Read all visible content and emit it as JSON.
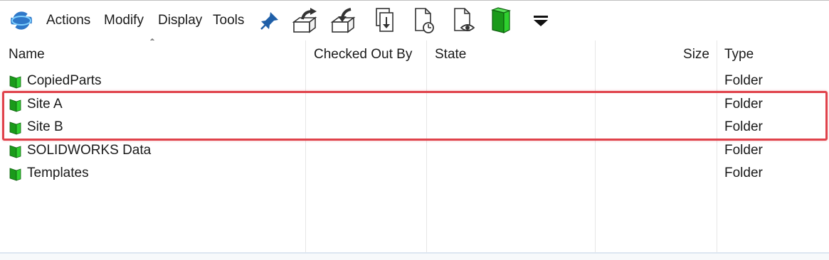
{
  "toolbar": {
    "menus": [
      "Actions",
      "Modify",
      "Display",
      "Tools"
    ],
    "icons": [
      "refresh-icon",
      "pin-icon",
      "check-out-icon",
      "check-in-icon",
      "get-latest-version-icon",
      "history-icon",
      "preview-icon",
      "vault-folder-icon",
      "more-dropdown-icon"
    ]
  },
  "columns": [
    {
      "label": "Name"
    },
    {
      "label": "Checked Out By"
    },
    {
      "label": "State"
    },
    {
      "label": "Size"
    },
    {
      "label": "Type"
    }
  ],
  "rows": [
    {
      "name": "CopiedParts",
      "checked_out_by": "",
      "state": "",
      "size": "",
      "type": "Folder"
    },
    {
      "name": "Site A",
      "checked_out_by": "",
      "state": "",
      "size": "",
      "type": "Folder"
    },
    {
      "name": "Site B",
      "checked_out_by": "",
      "state": "",
      "size": "",
      "type": "Folder"
    },
    {
      "name": "SOLIDWORKS Data",
      "checked_out_by": "",
      "state": "",
      "size": "",
      "type": "Folder"
    },
    {
      "name": "Templates",
      "checked_out_by": "",
      "state": "",
      "size": "",
      "type": "Folder"
    }
  ],
  "colors": {
    "folder_green": "#1db31d",
    "highlight_red": "#e0424b",
    "pin_blue": "#1f5fa8"
  }
}
